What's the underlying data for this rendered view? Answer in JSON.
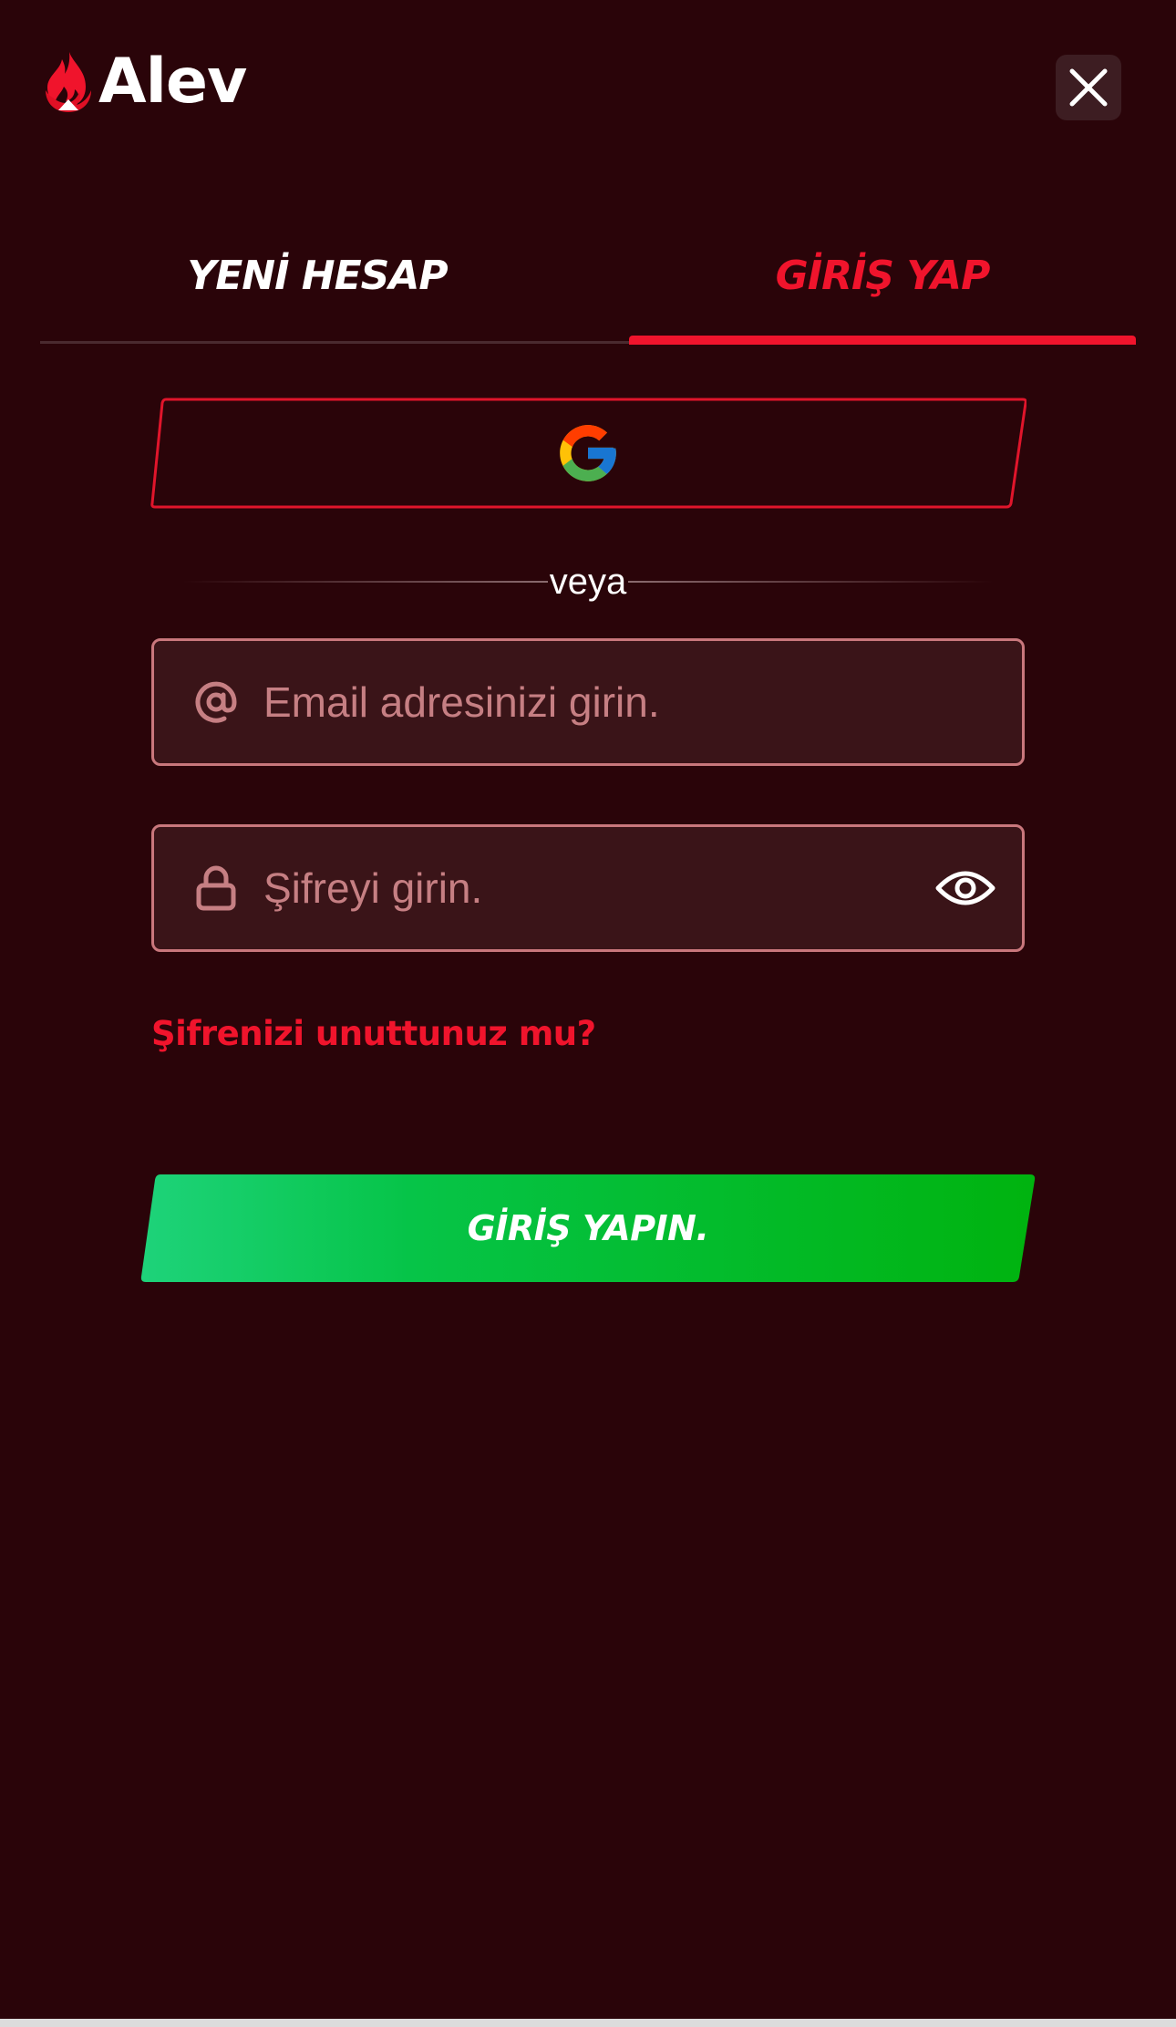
{
  "app": {
    "brand_name": "Alev",
    "logo_icon": "flame-icon",
    "colors": {
      "background": "#2a0409",
      "accent": "#f0142c",
      "primary_action": "#00b31b",
      "field_border": "#c9777c"
    }
  },
  "header": {
    "close_icon": "close-icon"
  },
  "tabs": [
    {
      "label": "YENİ HESAP",
      "active": false
    },
    {
      "label": "GİRİŞ YAP",
      "active": true
    }
  ],
  "social": {
    "google_icon": "google-icon"
  },
  "divider": {
    "text": "veya"
  },
  "form": {
    "email": {
      "placeholder": "Email adresinizi girin.",
      "value": "",
      "icon": "at-sign-icon"
    },
    "password": {
      "placeholder": "Şifreyi girin.",
      "value": "",
      "icon": "lock-icon",
      "toggle_icon": "eye-icon"
    },
    "forgot_label": "Şifrenizi unuttunuz mu?",
    "submit_label": "GİRİŞ YAPIN."
  }
}
